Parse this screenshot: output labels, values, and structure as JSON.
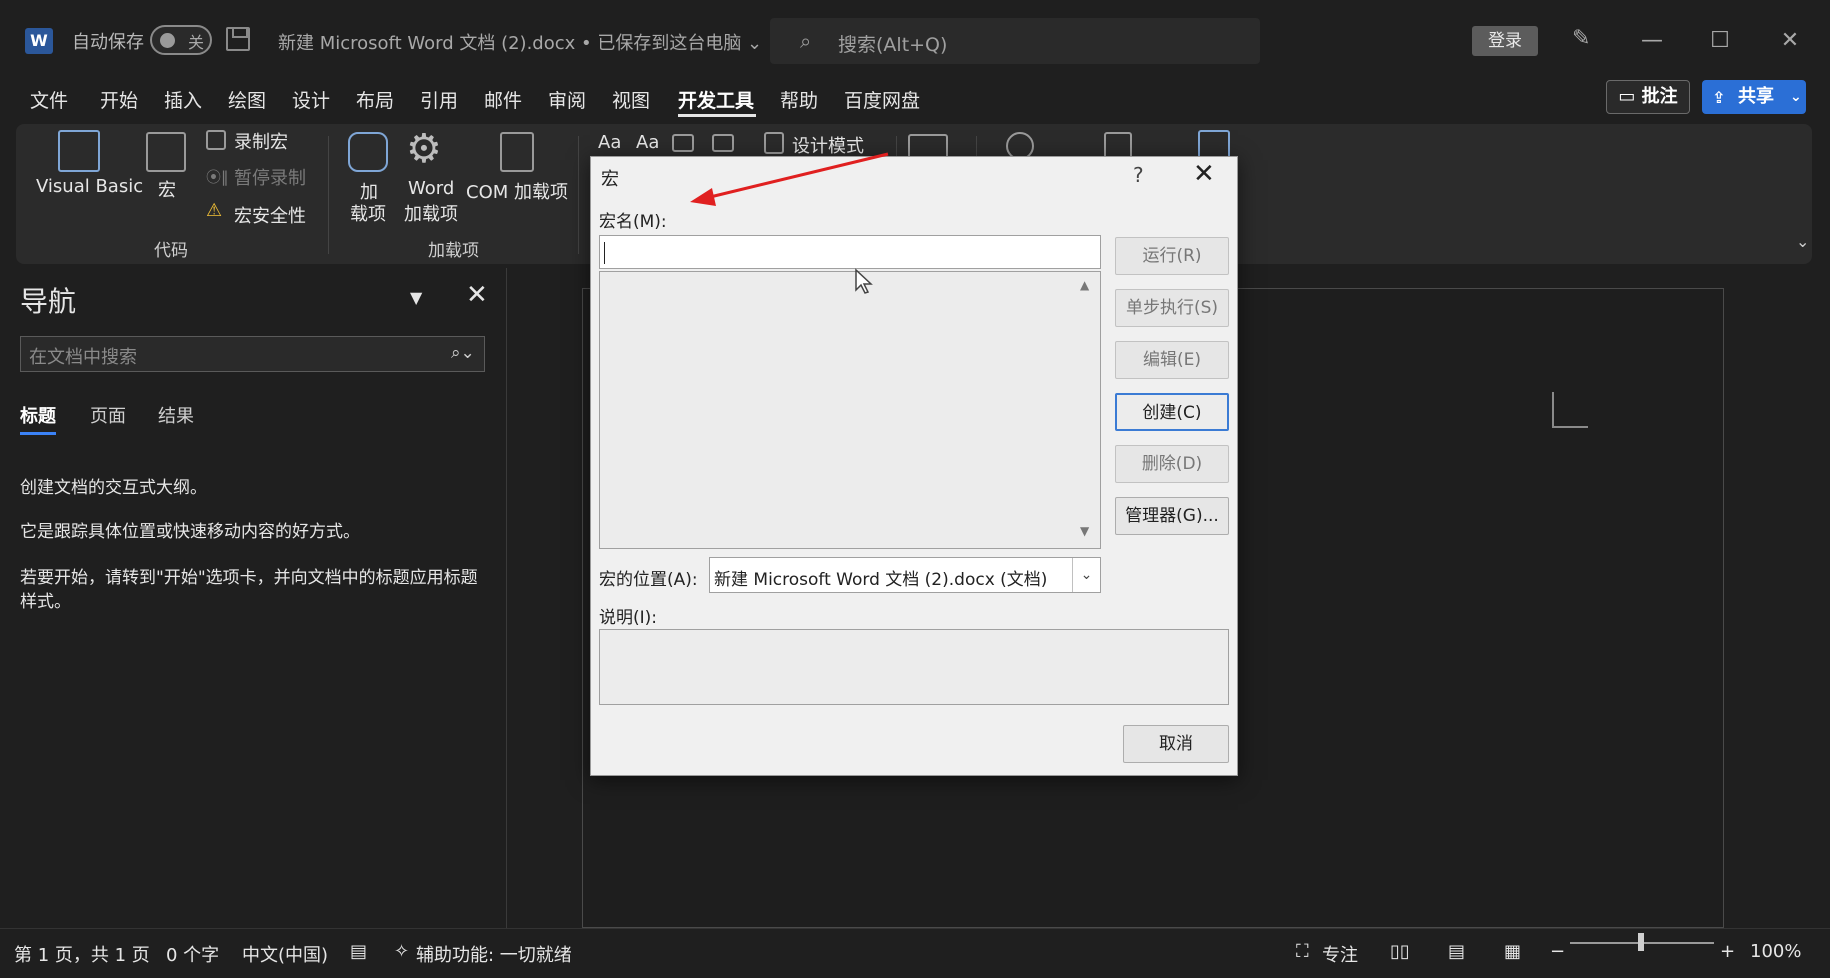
{
  "titlebar": {
    "app_logo": "W",
    "autosave_label": "自动保存",
    "autosave_state": "关",
    "doc_title": "新建 Microsoft Word 文档 (2).docx • 已保存到这台电脑 ⌄",
    "search_placeholder": "搜索(Alt+Q)",
    "login_label": "登录",
    "minimize": "—",
    "maximize": "☐",
    "close": "✕"
  },
  "menu": {
    "items": [
      "文件",
      "开始",
      "插入",
      "绘图",
      "设计",
      "布局",
      "引用",
      "邮件",
      "审阅",
      "视图",
      "开发工具",
      "帮助",
      "百度网盘"
    ],
    "active": "开发工具",
    "comment_label": "批注",
    "share_label": "共享"
  },
  "ribbon": {
    "visual_basic": "Visual Basic",
    "macro": "宏",
    "record_macro": "录制宏",
    "pause_record": "暂停录制",
    "macro_security": "宏安全性",
    "group_code": "代码",
    "addins_1": "加",
    "addins_2": "载项",
    "word_addins_1": "Word",
    "word_addins_2": "加载项",
    "com_addins": "COM 加载项",
    "group_addins": "加载项",
    "aa1": "Aa",
    "aa2": "Aa",
    "design_mode": "设计模式"
  },
  "nav": {
    "title": "导航",
    "search_placeholder": "在文档中搜索",
    "tabs": [
      "标题",
      "页面",
      "结果"
    ],
    "line1": "创建文档的交互式大纲。",
    "line2": "它是跟踪具体位置或快速移动内容的好方式。",
    "line3": "若要开始，请转到\"开始\"选项卡，并向文档中的标题应用标题样式。"
  },
  "dialog": {
    "title": "宏",
    "help": "?",
    "close": "✕",
    "macro_name_label": "宏名(M):",
    "macro_name_value": "",
    "buttons": {
      "run": "运行(R)",
      "step": "单步执行(S)",
      "edit": "编辑(E)",
      "create": "创建(C)",
      "delete": "删除(D)",
      "organizer": "管理器(G)..."
    },
    "location_label": "宏的位置(A):",
    "location_value": "新建 Microsoft Word 文档 (2).docx (文档)",
    "description_label": "说明(I):",
    "cancel": "取消"
  },
  "statusbar": {
    "page": "第 1 页，共 1 页",
    "words": "0 个字",
    "language": "中文(中国)",
    "accessibility": "辅助功能: 一切就绪",
    "focus": "专注",
    "zoom": "100%",
    "zoom_minus": "−",
    "zoom_plus": "+"
  },
  "colors": {
    "accent": "#2b6fd6",
    "arrow": "#e02020",
    "background": "#1f1f1f",
    "ribbon": "#2b2b2b"
  }
}
